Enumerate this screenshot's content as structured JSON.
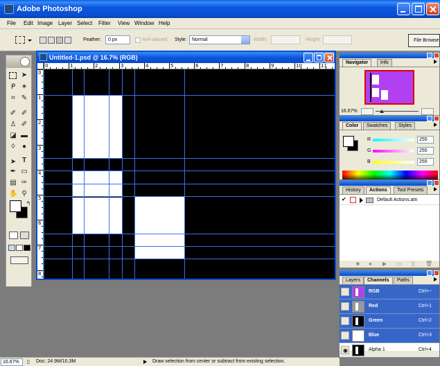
{
  "app": {
    "title": "Adobe Photoshop",
    "menu": [
      "File",
      "Edit",
      "Image",
      "Layer",
      "Select",
      "Filter",
      "View",
      "Window",
      "Help"
    ]
  },
  "options": {
    "feather_label": "Feather:",
    "feather_value": "0 px",
    "anti_aliased": "Anti-aliased",
    "style_label": "Style:",
    "style_value": "Normal",
    "width_label": "Width:",
    "height_label": "Height:",
    "file_browser": "File Browse"
  },
  "document": {
    "title": "Untitled-1.psd @ 16.7% (RGB)",
    "ruler_top": [
      "0",
      "1",
      "2",
      "3",
      "4",
      "5",
      "6",
      "7",
      "8",
      "9",
      "10",
      "11"
    ],
    "ruler_left": [
      "0",
      "1",
      "2",
      "3",
      "4",
      "5",
      "6",
      "7",
      "8"
    ],
    "canvas_color": "#000000",
    "shape_color": "#ffffff",
    "guide_color": "#3f6fe8"
  },
  "status": {
    "zoom": "16.67%",
    "doc": "Doc: 24.9M/10.3M",
    "hint": "Draw selection from center or subtract from existing selection."
  },
  "navigator": {
    "tabs": [
      "Navigator",
      "Info"
    ],
    "zoom": "16.67%",
    "preview_color": "#b040f0"
  },
  "color": {
    "tabs": [
      "Color",
      "Swatches",
      "Styles"
    ],
    "r_label": "R",
    "g_label": "G",
    "b_label": "B",
    "r": "255",
    "g": "255",
    "b": "255"
  },
  "actions": {
    "tabs": [
      "History",
      "Actions",
      "Tool Presets"
    ],
    "item": "Default Actions.atn"
  },
  "channels": {
    "tabs": [
      "Layers",
      "Channels",
      "Paths"
    ],
    "rows": [
      {
        "name": "RGB",
        "shortcut": "Ctrl+~"
      },
      {
        "name": "Red",
        "shortcut": "Ctrl+1"
      },
      {
        "name": "Green",
        "shortcut": "Ctrl+2"
      },
      {
        "name": "Blue",
        "shortcut": "Ctrl+3"
      },
      {
        "name": "Alpha 1",
        "shortcut": "Ctrl+4"
      }
    ]
  }
}
